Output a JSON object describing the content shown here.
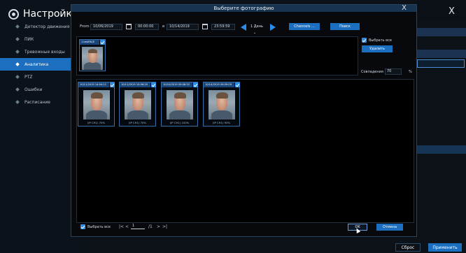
{
  "sidebar": {
    "title": "Настройки",
    "items": [
      {
        "label": "Детектор движения",
        "active": false
      },
      {
        "label": "ПИК",
        "active": false
      },
      {
        "label": "Тревожные входы",
        "active": false
      },
      {
        "label": "Аналитика",
        "active": true
      },
      {
        "label": "PTZ",
        "active": false
      },
      {
        "label": "Ошибки",
        "active": false
      },
      {
        "label": "Расписание",
        "active": false
      }
    ]
  },
  "background_page": {
    "close_glyph": "X",
    "reset_label": "Сброс",
    "apply_label": "Применить"
  },
  "modal": {
    "title": "Выберите фотографию",
    "close_glyph": "X",
    "filter": {
      "from_label": "From",
      "from_date": "10/06/2019",
      "from_time": "00:00:00",
      "to_label": "в",
      "to_date": "10/14/2019",
      "to_time": "23:59:59",
      "period": "1 День",
      "channels_label": "Channels ...",
      "search_label": "Поиск"
    },
    "source_face": {
      "label": "1.testFACE",
      "checked": true
    },
    "select_all_top": "Выбрать все",
    "delete_label": "Удалить",
    "match_label": "Совпадения",
    "match_value": "70",
    "match_unit": "%",
    "results": [
      {
        "timestamp": "10/11/2019 14:04:11",
        "caption": "(IP CH1) 70%",
        "checked": true
      },
      {
        "timestamp": "10/11/2019 10:56:20",
        "caption": "(IP CH1) 70%",
        "checked": true
      },
      {
        "timestamp": "10/10/2019 09:08:32",
        "caption": "(IP CH1) 100%",
        "checked": true
      },
      {
        "timestamp": "10/14/2019 09:09:09",
        "caption": "(IP CH1) 93%",
        "checked": true
      }
    ],
    "footer": {
      "select_all_label": "Выбрать все",
      "first_glyph": "|<",
      "prev_glyph": "<",
      "page": "1",
      "total_pages": "/1",
      "next_glyph": ">",
      "last_glyph": ">|",
      "ok_label": "OK",
      "cancel_label": "Отмена"
    }
  },
  "colors": {
    "accent": "#1b6fbe",
    "checkbox": "#2d8fe8",
    "header": "#17334f"
  }
}
